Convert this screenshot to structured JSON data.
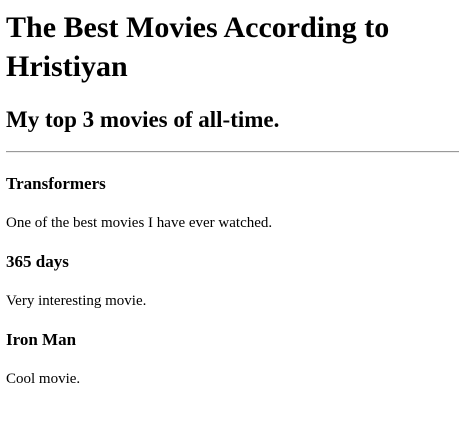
{
  "header": {
    "title": "The Best Movies According to Hristiyan",
    "subtitle": "My top 3 movies of all-time."
  },
  "movies": [
    {
      "title": "Transformers",
      "description": "One of the best movies I have ever watched."
    },
    {
      "title": "365 days",
      "description": "Very interesting movie."
    },
    {
      "title": "Iron Man",
      "description": "Cool movie."
    }
  ]
}
